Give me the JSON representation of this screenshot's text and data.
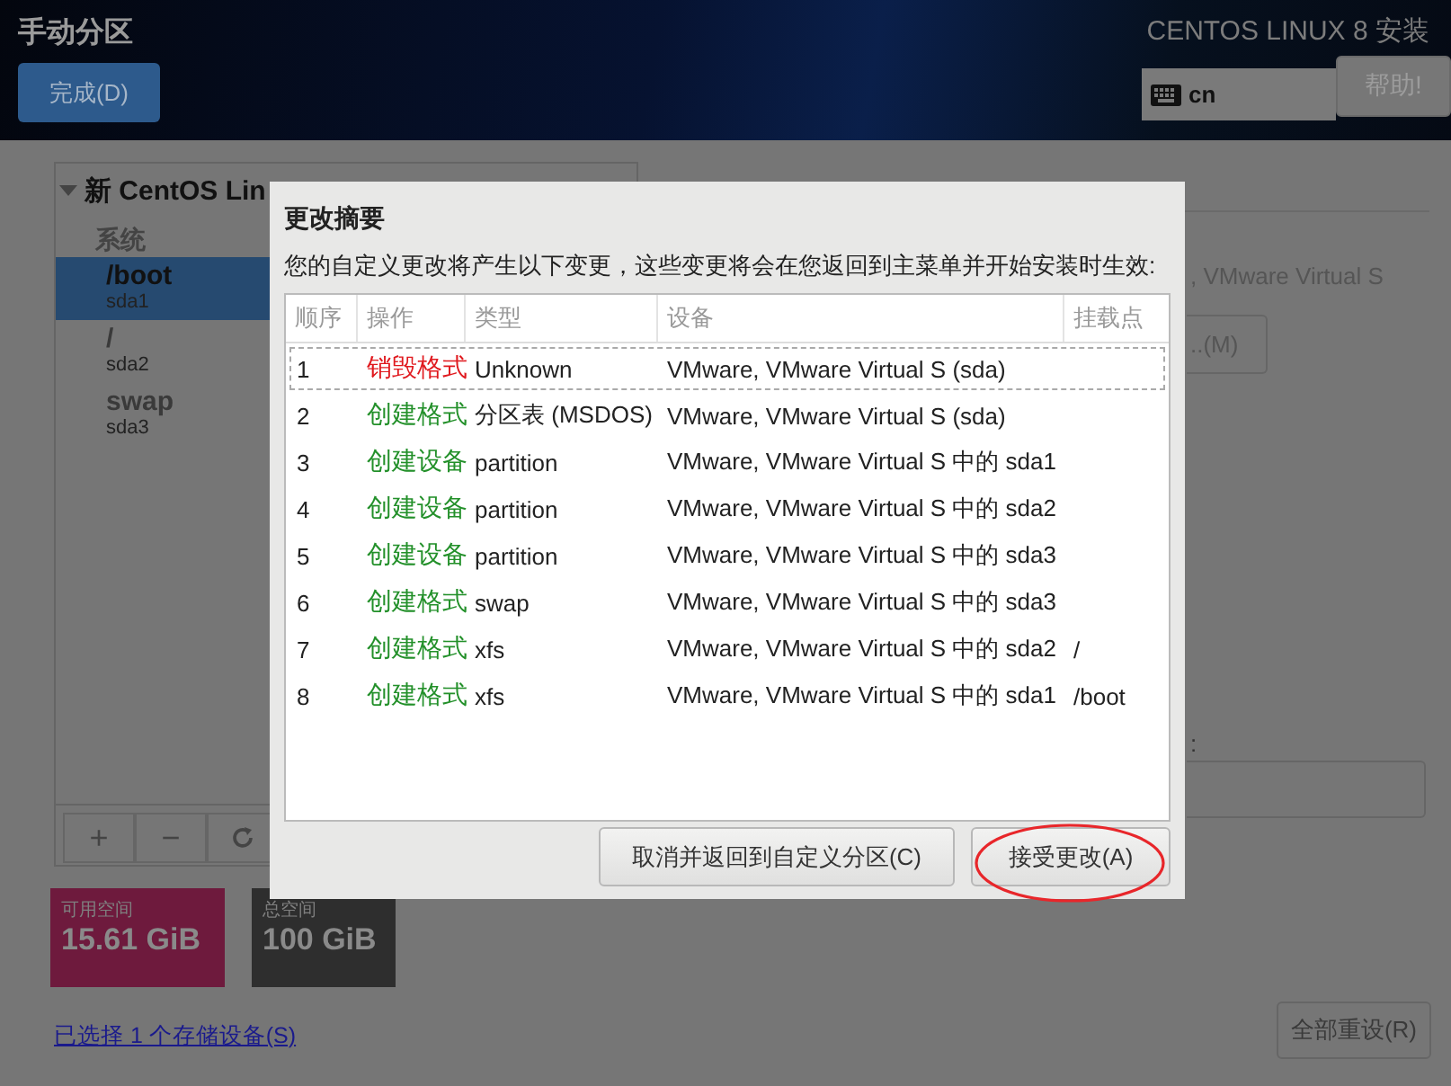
{
  "header": {
    "title": "手动分区",
    "done_button": "完成(D)",
    "product": "CENTOS LINUX 8 安装",
    "keyboard": "cn",
    "help_button": "帮助!"
  },
  "tree": {
    "group": "新 CentOS Lin",
    "expanded": true,
    "section": "系统",
    "items": [
      {
        "mount": "/boot",
        "device": "sda1",
        "selected": true
      },
      {
        "mount": "/",
        "device": "sda2",
        "selected": false
      },
      {
        "mount": "swap",
        "device": "sda3",
        "selected": false
      }
    ]
  },
  "toolbar": [
    "+",
    "−"
  ],
  "space": {
    "available_label": "可用空间",
    "available": "15.61 GiB",
    "total_label": "总空间",
    "total": "100 GiB"
  },
  "storage_link": "已选择 1 个存储设备(S)",
  "reset_button": "全部重设(R)",
  "detail": {
    "device_desc": ", VMware Virtual S",
    "modify_button": "..(M)",
    "field_label": ":"
  },
  "dialog": {
    "title": "更改摘要",
    "message": "您的自定义更改将产生以下变更，这些变更将会在您返回到主菜单并开始安装时生效:",
    "columns": [
      "顺序",
      "操作",
      "类型",
      "设备",
      "挂载点"
    ],
    "rows": [
      {
        "order": "1",
        "action": "销毁格式",
        "kind": "destroy",
        "type": "Unknown",
        "device": "VMware, VMware Virtual S (sda)",
        "focused": true
      },
      {
        "order": "2",
        "action": "创建格式",
        "kind": "create",
        "type": "分区表 (MSDOS)",
        "device": "VMware, VMware Virtual S (sda)",
        "focused": false
      },
      {
        "order": "3",
        "action": "创建设备",
        "kind": "create",
        "type": "partition",
        "device": "VMware, VMware Virtual S 中的 sda1",
        "focused": false
      },
      {
        "order": "4",
        "action": "创建设备",
        "kind": "create",
        "type": "partition",
        "device": "VMware, VMware Virtual S 中的 sda2",
        "focused": false
      },
      {
        "order": "5",
        "action": "创建设备",
        "kind": "create",
        "type": "partition",
        "device": "VMware, VMware Virtual S 中的 sda3",
        "focused": false
      },
      {
        "order": "6",
        "action": "创建格式",
        "kind": "create",
        "type": "swap",
        "device": "VMware, VMware Virtual S 中的 sda3",
        "focused": false
      },
      {
        "order": "7",
        "action": "创建格式",
        "kind": "create",
        "type": "xfs",
        "device": "VMware, VMware Virtual S 中的 sda2",
        "mount": "/",
        "focused": false
      },
      {
        "order": "8",
        "action": "创建格式",
        "kind": "create",
        "type": "xfs",
        "device": "VMware, VMware Virtual S 中的 sda1",
        "mount": "/boot",
        "focused": false
      }
    ],
    "buttons": [
      {
        "label": "取消并返回到自定义分区(C)",
        "highlighted": false
      },
      {
        "label": "接受更改(A)",
        "highlighted": true
      }
    ]
  }
}
